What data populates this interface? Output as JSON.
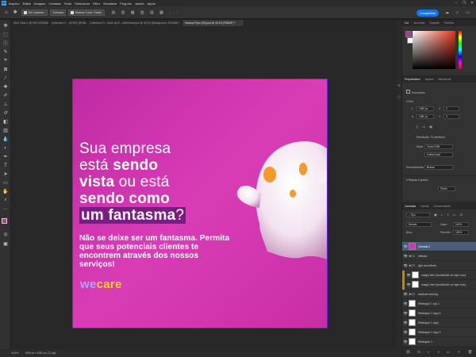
{
  "app": {
    "logo": "Ps",
    "menu": [
      "Arquivo",
      "Editar",
      "Imagem",
      "Camada",
      "Texto",
      "Selecionar",
      "Filtro",
      "Visualizar",
      "Plug-ins",
      "Janela",
      "Ajuda"
    ],
    "window_controls": [
      "–",
      "❐",
      "✕"
    ]
  },
  "options_bar": {
    "auto_select": "Sel. Automá...",
    "layer_select": "Camada",
    "show_transform": "Mostrar Contr. Transf.",
    "share_label": "Compartilhar"
  },
  "tabs": [
    {
      "label": "Sem Título-1 @ 95% (RGB/8#) *",
      "active": false
    },
    {
      "label": "Collection H… @ 95% (RGB/8#) *",
      "active": false
    },
    {
      "label": "Collection 01 - Mock Up 8 - Letterhead.psd @ 33,3% (Background, RGB/8#) *",
      "active": false
    },
    {
      "label": "Mockup Flyer (09).psd @ 44,4% (RGB/8*) *",
      "active": true
    }
  ],
  "artwork": {
    "headline_lines": [
      {
        "pre": "Sua empresa",
        "bold": "",
        "post": ""
      },
      {
        "pre": "está ",
        "bold": "sendo",
        "post": ""
      },
      {
        "pre": "",
        "bold": "vista",
        "post": " ou está"
      },
      {
        "pre": "",
        "bold": "sendo como",
        "post": ""
      },
      {
        "pre": "",
        "bold": "um fantasma",
        "post": "?"
      }
    ],
    "subtext": "Não se deixe ser um fantasma. Permita que seus potenciais clientes te encontrem através dos nossos serviços!",
    "brand_we": "we",
    "brand_care": "care",
    "colors": {
      "background": "#d03ab0",
      "highlight": "#7a1d83",
      "brand_we": "#b7a3ff",
      "brand_care": "#ffd028",
      "ghost_eyes": "#f59a2a"
    }
  },
  "status": {
    "zoom": "44,4%",
    "doc_size": "1080 px x 1080 px (72 ppi)"
  },
  "panels": {
    "color_tabs": [
      "Cor",
      "Amostras",
      "Degradê",
      "Padrões"
    ],
    "props_tabs": [
      "Propriedades",
      "Ajustes",
      "Bibliotecas"
    ],
    "doc_label": "Documento",
    "tela_label": "Tela",
    "width_label": "L",
    "width_value": "1080 px",
    "x_label": "X",
    "x_value": "0",
    "height_label": "A",
    "height_value": "1080 px",
    "y_label": "Y",
    "y_value": "0",
    "resolution": "Resolução: 72 pixels/pol",
    "mode_label": "Modo",
    "mode_value": "Cores RGB",
    "bits_value": "8 bits/Canal",
    "fill_label": "Preenchimento",
    "fill_value": "Branco",
    "guides_label": "Réguas e grades",
    "guides_unit": "Pixels",
    "layers_tabs": [
      "Camadas",
      "Canais",
      "Demarcadores"
    ],
    "kind_filter": "Tipo",
    "blend_mode": "Normal",
    "opacity_label": "Opac.:",
    "opacity_value": "100%",
    "lock_label": "Bloq.:",
    "fill_pct_label": "Preench.:",
    "fill_pct_value": "100%",
    "layers": [
      {
        "name": "Camada 1",
        "type": "pink",
        "selected": true
      },
      {
        "name": "effects2",
        "type": "folder",
        "selected": false
      },
      {
        "name": "light and effects",
        "type": "folder",
        "selected": false
      },
      {
        "name": "image| here (doubleclick on layer icon)",
        "type": "smart",
        "selected": false,
        "mark": true
      },
      {
        "name": "image| here (doubleclick on layer icon)",
        "type": "smart",
        "selected": false,
        "mark": true
      },
      {
        "name": "shadows and fog",
        "type": "folder",
        "selected": false
      },
      {
        "name": "Retângulo 1 cop 2",
        "type": "rect",
        "selected": false
      },
      {
        "name": "Retângulo 1 copy 4",
        "type": "rect",
        "selected": false
      },
      {
        "name": "Retângulo 1 copy",
        "type": "rect",
        "selected": false
      },
      {
        "name": "Retângulo 1 copy 3",
        "type": "rect",
        "selected": false
      },
      {
        "name": "Retângulo 1",
        "type": "rect",
        "selected": false
      }
    ],
    "bottom_icons": [
      "⛓",
      "fx",
      "◐",
      "◑",
      "▭",
      "＋",
      "🗑"
    ]
  }
}
